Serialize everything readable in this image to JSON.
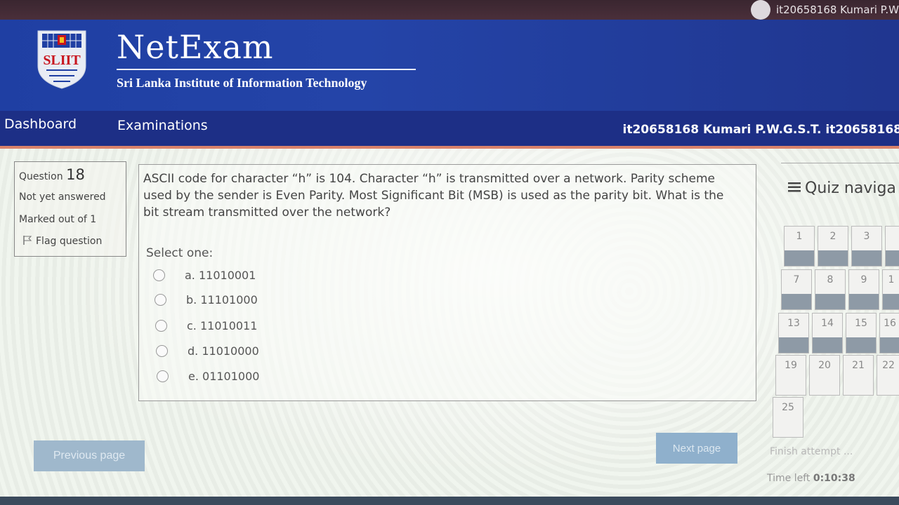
{
  "top_user": "it20658168 Kumari P.W",
  "header": {
    "crest_label": "SLIIT",
    "title": "NetExam",
    "subtitle": "Sri Lanka Institute of Information Technology"
  },
  "nav": {
    "dashboard": "Dashboard",
    "examinations": "Examinations",
    "user": "it20658168 Kumari P.W.G.S.T. it20658168"
  },
  "question_info": {
    "label": "Question",
    "number": "18",
    "status": "Not yet answered",
    "marks": "Marked out of 1",
    "flag": "Flag question"
  },
  "question": {
    "text": "ASCII code for character “h” is 104. Character “h” is transmitted over a network. Parity scheme used by the sender is Even Parity. Most Significant Bit (MSB) is used as the parity bit. What is the bit stream transmitted over the network?",
    "select_label": "Select one:",
    "options": [
      "a. 11010001",
      "b. 11101000",
      "c. 11010011",
      "d. 11010000",
      "e. 01101000"
    ]
  },
  "quiz_nav": {
    "title": "Quiz naviga",
    "buttons": [
      "1",
      "2",
      "3",
      "7",
      "8",
      "9",
      "1",
      "13",
      "14",
      "15",
      "16",
      "19",
      "20",
      "21",
      "22",
      "25"
    ]
  },
  "buttons": {
    "previous": "Previous page",
    "next": "Next page",
    "finish": "Finish attempt ..."
  },
  "timer": {
    "label": "Time left",
    "value": "0:10:38"
  },
  "colors": {
    "header_blue": "#2444a8",
    "nav_blue": "#1d2f86",
    "nav_accent": "#d9826b"
  }
}
